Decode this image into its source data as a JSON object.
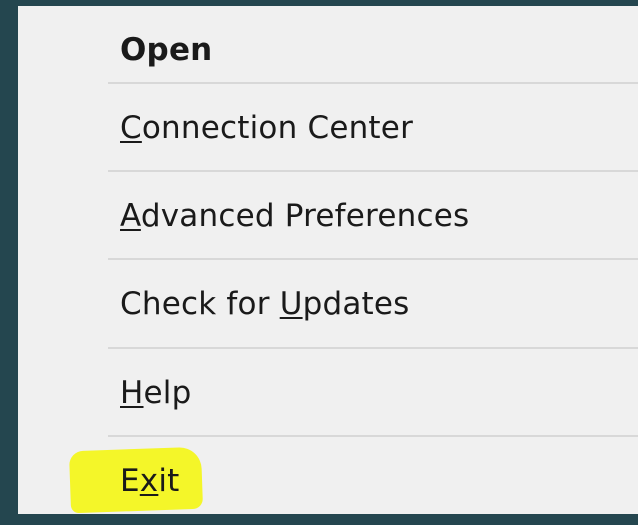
{
  "menu": {
    "items": [
      {
        "id": "open",
        "pre": "Open",
        "key": "",
        "post": "",
        "bold": true
      },
      {
        "id": "connection-center",
        "pre": "",
        "key": "C",
        "post": "onnection Center",
        "bold": false
      },
      {
        "id": "advanced-preferences",
        "pre": "",
        "key": "A",
        "post": "dvanced Preferences",
        "bold": false
      },
      {
        "id": "check-for-updates",
        "pre": "Check for ",
        "key": "U",
        "post": "pdates",
        "bold": false
      },
      {
        "id": "help",
        "pre": "",
        "key": "H",
        "post": "elp",
        "bold": false
      },
      {
        "id": "exit",
        "pre": "E",
        "key": "x",
        "post": "it",
        "bold": false
      }
    ],
    "highlight_color": "#f3f51e"
  }
}
